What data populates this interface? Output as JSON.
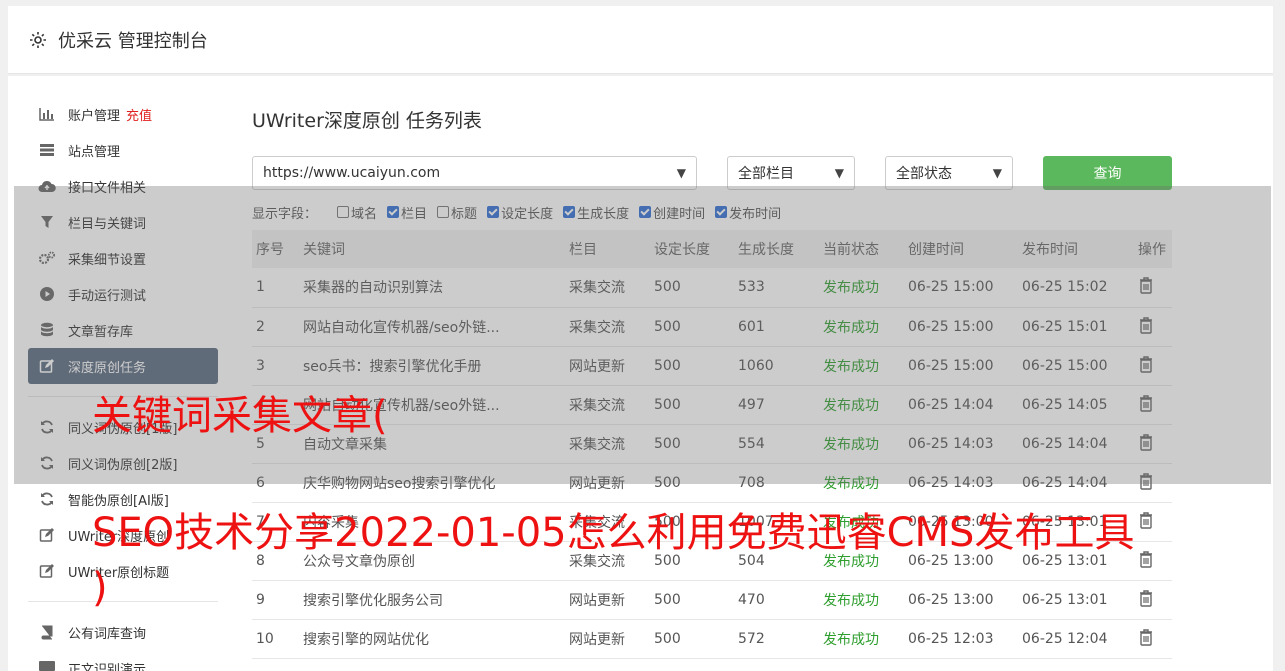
{
  "header": {
    "title": "优采云 管理控制台"
  },
  "sidebar": {
    "items": [
      {
        "label": "账户管理",
        "badge": "充值",
        "icon": "bar-chart-icon"
      },
      {
        "label": "站点管理",
        "icon": "server-icon"
      },
      {
        "label": "接口文件相关",
        "icon": "cloud-upload-icon"
      },
      {
        "label": "栏目与关键词",
        "icon": "filter-icon"
      },
      {
        "label": "采集细节设置",
        "icon": "gears-icon"
      },
      {
        "label": "手动运行测试",
        "icon": "play-circle-icon"
      },
      {
        "label": "文章暂存库",
        "icon": "database-icon"
      },
      {
        "label": "深度原创任务",
        "icon": "edit-icon",
        "active": true
      },
      {
        "label": "同义词伪原创[1版]",
        "icon": "refresh-icon"
      },
      {
        "label": "同义词伪原创[2版]",
        "icon": "refresh-icon"
      },
      {
        "label": "智能伪原创[AI版]",
        "icon": "refresh-icon"
      },
      {
        "label": "UWriter深度原创",
        "icon": "edit-icon"
      },
      {
        "label": "UWriter原创标题",
        "icon": "edit-icon"
      },
      {
        "label": "公有词库查询",
        "icon": "book-icon"
      },
      {
        "label": "正文识别演示",
        "icon": "monitor-icon"
      }
    ]
  },
  "main": {
    "title": "UWriter深度原创 任务列表",
    "site_select": "https://www.ucaiyun.com",
    "column_select": "全部栏目",
    "status_select": "全部状态",
    "query_label": "查询",
    "fields_label": "显示字段：",
    "fields": [
      {
        "label": "域名",
        "checked": false
      },
      {
        "label": "栏目",
        "checked": true
      },
      {
        "label": "标题",
        "checked": false
      },
      {
        "label": "设定长度",
        "checked": true
      },
      {
        "label": "生成长度",
        "checked": true
      },
      {
        "label": "创建时间",
        "checked": true
      },
      {
        "label": "发布时间",
        "checked": true
      }
    ],
    "columns": [
      "序号",
      "关键词",
      "栏目",
      "设定长度",
      "生成长度",
      "当前状态",
      "创建时间",
      "发布时间",
      "操作"
    ],
    "rows": [
      [
        "1",
        "采集器的自动识别算法",
        "采集交流",
        "500",
        "533",
        "发布成功",
        "06-25 15:00",
        "06-25 15:02"
      ],
      [
        "2",
        "网站自动化宣传机器/seo外链...",
        "采集交流",
        "500",
        "601",
        "发布成功",
        "06-25 15:00",
        "06-25 15:01"
      ],
      [
        "3",
        "seo兵书：搜索引擎优化手册",
        "网站更新",
        "500",
        "1060",
        "发布成功",
        "06-25 15:00",
        "06-25 15:00"
      ],
      [
        "4",
        "网站自动化宣传机器/seo外链...",
        "采集交流",
        "500",
        "497",
        "发布成功",
        "06-25 14:04",
        "06-25 14:05"
      ],
      [
        "5",
        "自动文章采集",
        "采集交流",
        "500",
        "554",
        "发布成功",
        "06-25 14:03",
        "06-25 14:04"
      ],
      [
        "6",
        "庆华购物网站seo搜索引擎优化",
        "网站更新",
        "500",
        "708",
        "发布成功",
        "06-25 14:03",
        "06-25 14:04"
      ],
      [
        "7",
        "内容采集",
        "采集交流",
        "500",
        "1007",
        "发布成功",
        "06-25 13:00",
        "06-25 13:01"
      ],
      [
        "8",
        "公众号文章伪原创",
        "采集交流",
        "500",
        "504",
        "发布成功",
        "06-25 13:00",
        "06-25 13:01"
      ],
      [
        "9",
        "搜索引擎优化服务公司",
        "网站更新",
        "500",
        "470",
        "发布成功",
        "06-25 13:00",
        "06-25 13:01"
      ],
      [
        "10",
        "搜索引擎的网站优化",
        "网站更新",
        "500",
        "572",
        "发布成功",
        "06-25 12:03",
        "06-25 12:04"
      ]
    ]
  },
  "watermark": {
    "line1": "关键词采集文章(",
    "line2": "SEO技术分享2022-01-05怎么利用免费迅睿CMS发布工具",
    "line3": ")"
  },
  "colors": {
    "accent": "#5cb85c",
    "active_nav": "#5a6a80",
    "success": "#2e9e2e",
    "caption": "#ee1111"
  }
}
